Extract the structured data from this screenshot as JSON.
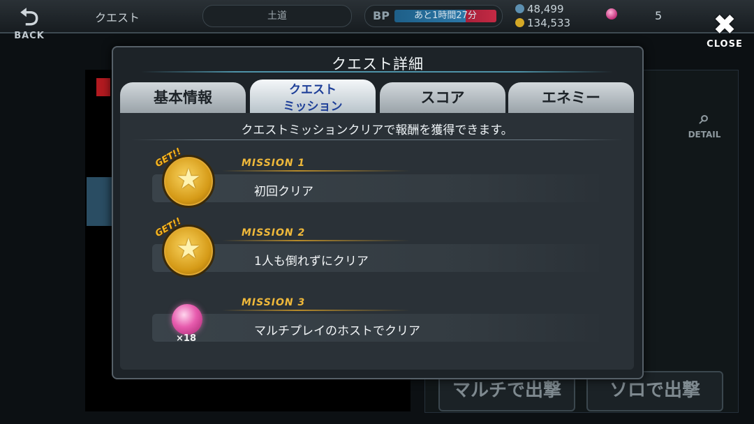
{
  "header": {
    "back_label": "BACK",
    "title": "クエスト",
    "area": "土道",
    "bp_label": "BP",
    "bp_timer": "あと1時間27分",
    "coins": "48,499",
    "gold": "134,533",
    "gems": "5",
    "close_label": "CLOSE"
  },
  "background": {
    "detail_label": "DETAIL",
    "multi_button": "マルチで出撃",
    "solo_button": "ソロで出撃"
  },
  "modal": {
    "title": "クエスト詳細",
    "tabs": [
      {
        "label": "基本情報"
      },
      {
        "label_line1": "クエスト",
        "label_line2": "ミッション"
      },
      {
        "label": "スコア"
      },
      {
        "label": "エネミー"
      }
    ],
    "description": "クエストミッションクリアで報酬を獲得できます。",
    "missions": [
      {
        "heading": "MISSION 1",
        "text": "初回クリア",
        "badge": "GET!!",
        "reward_icon": "gold-star-medal-icon"
      },
      {
        "heading": "MISSION 2",
        "text": "1人も倒れずにクリア",
        "badge": "GET!!",
        "reward_icon": "gold-star-medal-icon"
      },
      {
        "heading": "MISSION 3",
        "text": "マルチプレイのホストでクリア",
        "reward_icon": "pink-gem-icon",
        "reward_qty": "×18"
      }
    ]
  },
  "colors": {
    "mission_heading": "#f0b93a",
    "active_tab_text": "#1e3f98",
    "modal_bg": "#1d2328"
  }
}
